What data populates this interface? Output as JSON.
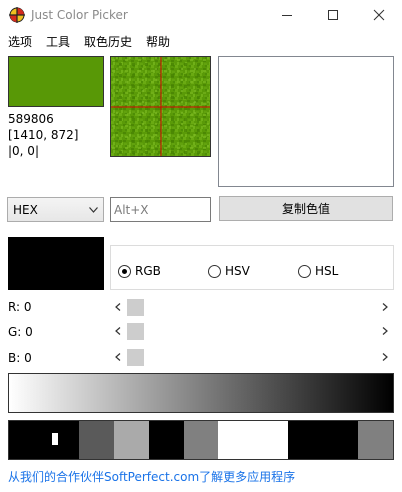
{
  "window": {
    "title": "Just Color Picker"
  },
  "menu": {
    "items": [
      {
        "label": "选项"
      },
      {
        "label": "工具"
      },
      {
        "label": "取色历史"
      },
      {
        "label": "帮助"
      }
    ]
  },
  "color": {
    "hex_text": "589806",
    "swatch_color": "#589806",
    "screen_pos": "[1410, 872]",
    "offset": "|0, 0|"
  },
  "format": {
    "selected": "HEX"
  },
  "hotkey": {
    "placeholder": "Alt+X"
  },
  "copy_button": {
    "label": "复制色值"
  },
  "mode": {
    "options": [
      {
        "label": "RGB",
        "selected": true
      },
      {
        "label": "HSV",
        "selected": false
      },
      {
        "label": "HSL",
        "selected": false
      }
    ]
  },
  "channels": [
    {
      "label": "R: 0",
      "value": 0
    },
    {
      "label": "G: 0",
      "value": 0
    },
    {
      "label": "B: 0",
      "value": 0
    }
  ],
  "history": {
    "colors": [
      "#000000",
      "#000000",
      "#5a5a5a",
      "#aaaaaa",
      "#000000",
      "#808080",
      "#ffffff",
      "#ffffff",
      "#000000",
      "#000000",
      "#808080"
    ]
  },
  "footer": {
    "link_text": "从我们的合作伙伴SoftPerfect.com了解更多应用程序"
  },
  "colors": {
    "accent": "#1a73e8",
    "crosshair": "#d40000"
  }
}
